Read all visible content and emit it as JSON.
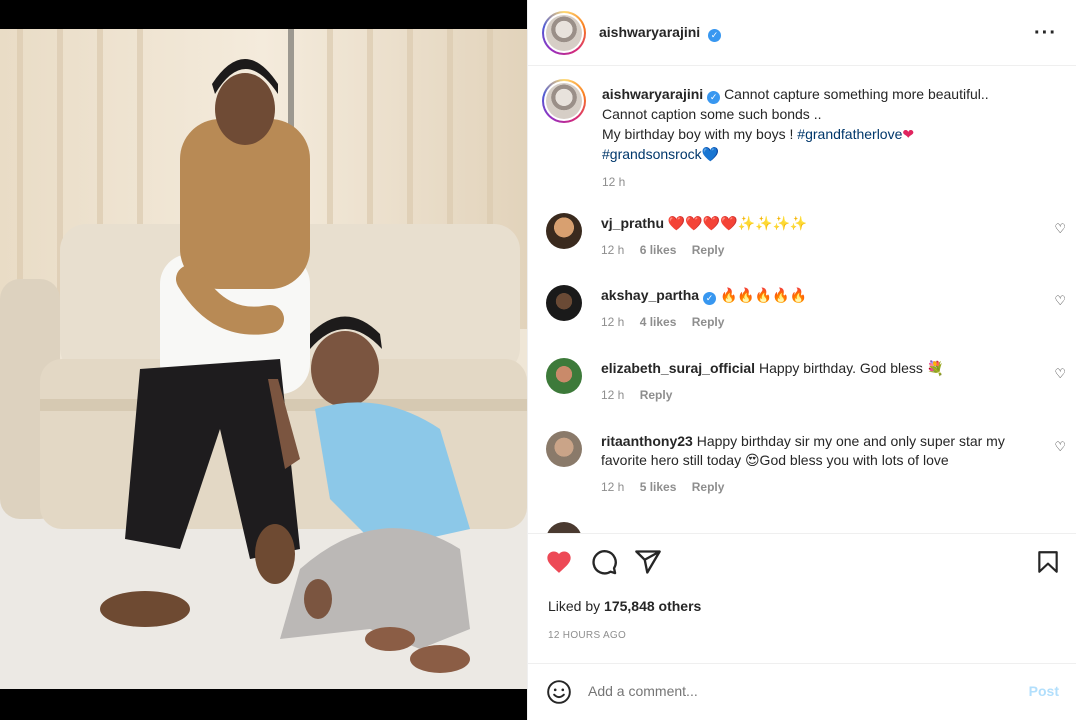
{
  "post": {
    "username": "aishwaryarajini",
    "caption_lines": [
      "Cannot capture something more beautiful..",
      "Cannot caption some such bonds ..",
      "My birthday boy with my boys ! "
    ],
    "hashtag1": "#grandfatherlove",
    "hashtag2": "#grandsonsrock",
    "caption_age": "12 h"
  },
  "comments": [
    {
      "user": "vj_prathu",
      "verified": false,
      "text": "❤️❤️❤️❤️✨✨✨✨",
      "age": "12 h",
      "likes": "6 likes",
      "reply": "Reply"
    },
    {
      "user": "akshay_partha",
      "verified": true,
      "text": "🔥🔥🔥🔥🔥",
      "age": "12 h",
      "likes": "4 likes",
      "reply": "Reply"
    },
    {
      "user": "elizabeth_suraj_official",
      "verified": false,
      "text": "Happy birthday. God bless 💐",
      "age": "12 h",
      "likes": "",
      "reply": "Reply"
    },
    {
      "user": "ritaanthony23",
      "verified": false,
      "text": "Happy birthday sir my one and only super star my favorite hero still today 😍God bless you with lots of love",
      "age": "12 h",
      "likes": "5 likes",
      "reply": "Reply"
    }
  ],
  "liked_by_prefix": "Liked by ",
  "liked_by_count": "175,848 others",
  "post_time": "12 HOURS AGO",
  "comment_placeholder": "Add a comment...",
  "post_button": "Post",
  "icons": [
    "heart-icon",
    "comment-icon",
    "share-icon",
    "bookmark-icon",
    "more-options-icon",
    "emoji-icon",
    "verified-icon"
  ],
  "colors": {
    "like_red": "#ed4956",
    "link_blue": "#00376b",
    "verified_blue": "#3897f0",
    "post_disabled": "#b2dffc"
  }
}
